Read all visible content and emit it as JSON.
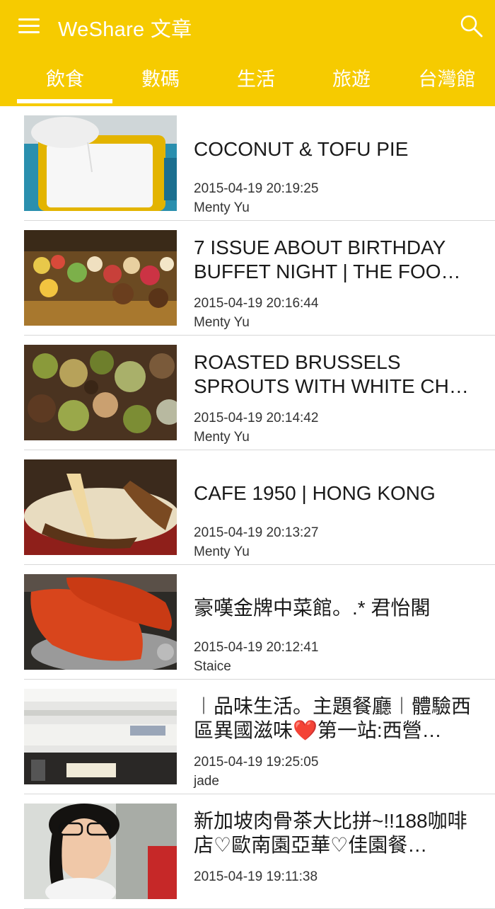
{
  "header": {
    "title": "WeShare 文章",
    "background_color": "#f6cb00",
    "menu_icon": "hamburger-menu-icon",
    "search_icon": "search-icon"
  },
  "tabs": [
    {
      "label": "飲食",
      "selected": true
    },
    {
      "label": "數碼",
      "selected": false
    },
    {
      "label": "生活",
      "selected": false
    },
    {
      "label": "旅遊",
      "selected": false
    },
    {
      "label": "台灣館",
      "selected": false
    }
  ],
  "articles": [
    {
      "title": "COCONUT & TOFU PIE",
      "date": "2015-04-19 20:19:25",
      "author": "Menty Yu",
      "thumbnail": "coconut-tofu-pie-photo"
    },
    {
      "title": "7 ISSUE ABOUT BIRTHDAY BUFFET NIGHT | THE FOO…",
      "date": "2015-04-19 20:16:44",
      "author": "Menty Yu",
      "thumbnail": "dessert-buffet-photo"
    },
    {
      "title": "ROASTED BRUSSELS SPROUTS WITH WHITE CH…",
      "date": "2015-04-19 20:14:42",
      "author": "Menty Yu",
      "thumbnail": "brussels-sprouts-photo"
    },
    {
      "title": "CAFE 1950 | HONG KONG",
      "date": "2015-04-19 20:13:27",
      "author": "Menty Yu",
      "thumbnail": "cheese-dish-photo"
    },
    {
      "title": "豪嘆金牌中菜館。.* 君怡閣",
      "date": "2015-04-19 20:12:41",
      "author": "Staice",
      "thumbnail": "roast-pig-photo"
    },
    {
      "title": "︱品味生活。主題餐廳︱體驗西區異國滋味❤️第一站:西營…",
      "date": "2015-04-19 19:25:05",
      "author": "jade",
      "thumbnail": "restaurant-interior-photo"
    },
    {
      "title": "新加坡肉骨茶大比拼~!!188咖啡店♡歐南園亞華♡佳園餐…",
      "date": "2015-04-19 19:11:38",
      "author": "",
      "thumbnail": "woman-portrait-photo"
    }
  ]
}
